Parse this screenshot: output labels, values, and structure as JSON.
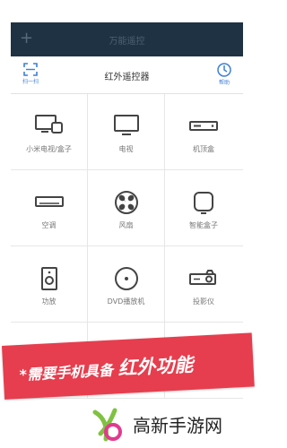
{
  "app": {
    "title": "万能遥控"
  },
  "header": {
    "title": "红外遥控器",
    "scan_label": "扫一扫",
    "help_label": "帮助"
  },
  "devices": [
    {
      "label": "小米电视/盒子",
      "icon": "tv-box-icon"
    },
    {
      "label": "电视",
      "icon": "tv-icon"
    },
    {
      "label": "机顶盒",
      "icon": "set-top-box-icon"
    },
    {
      "label": "空调",
      "icon": "air-conditioner-icon"
    },
    {
      "label": "风扇",
      "icon": "fan-icon"
    },
    {
      "label": "智能盒子",
      "icon": "smart-box-icon"
    },
    {
      "label": "功放",
      "icon": "amplifier-icon"
    },
    {
      "label": "DVD播放机",
      "icon": "dvd-icon"
    },
    {
      "label": "投影仪",
      "icon": "projector-icon"
    }
  ],
  "promo": {
    "prefix": "*需要手机具备 ",
    "highlight": "红外功能",
    "color": "#e63e4e"
  },
  "watermark": {
    "text": "高新手游网"
  },
  "colors": {
    "topbar": "#1f3243",
    "accent": "#3d7fd6"
  }
}
